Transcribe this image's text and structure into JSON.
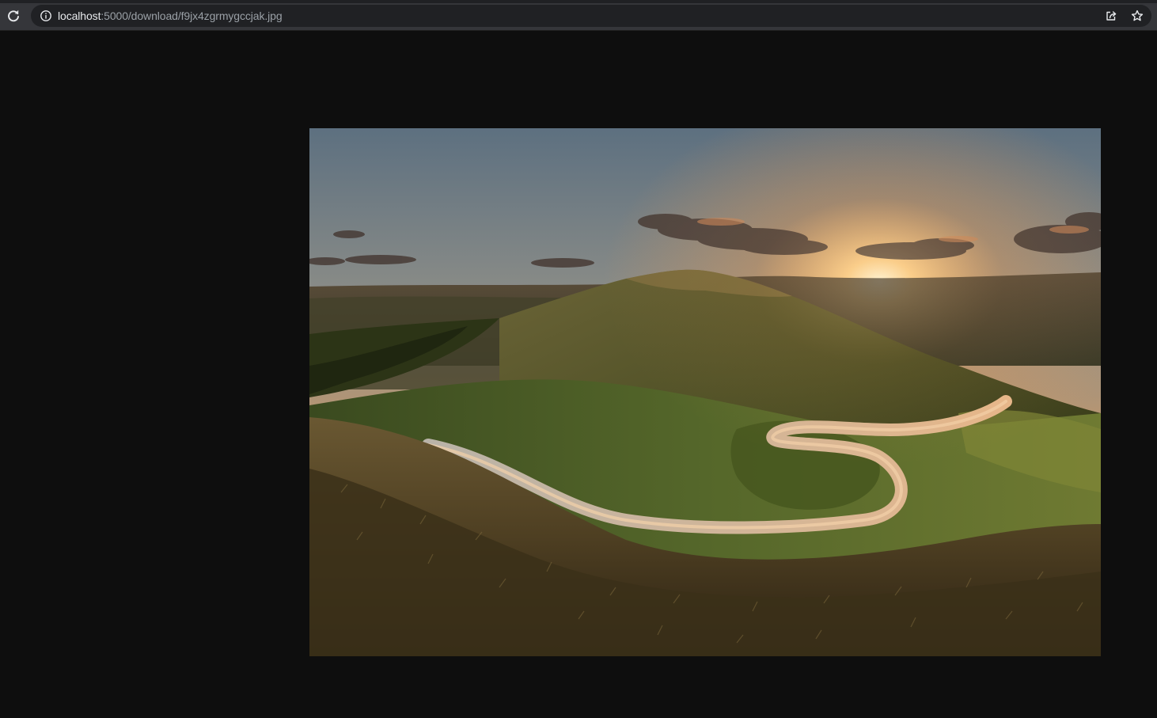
{
  "browser": {
    "url_host": "localhost",
    "url_path": ":5000/download/f9jx4zgrmygccjak.jpg",
    "icons": {
      "reload": "reload-icon",
      "site_info": "info-icon",
      "share": "share-icon",
      "bookmark": "star-icon"
    }
  },
  "viewer": {
    "background_color": "#0e0e0e",
    "image": {
      "subject": "landscape-photo"
    }
  }
}
